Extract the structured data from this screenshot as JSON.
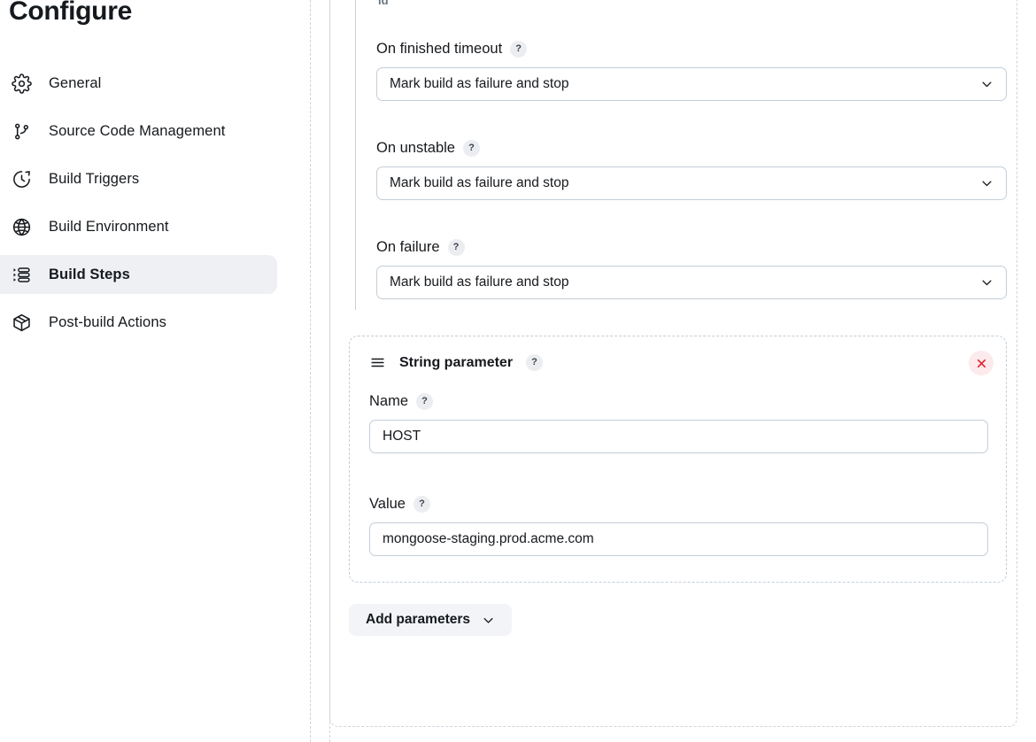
{
  "sidebar": {
    "title": "Configure",
    "items": [
      {
        "label": "General",
        "icon": "gear-icon",
        "active": false
      },
      {
        "label": "Source Code Management",
        "icon": "git-branch-icon",
        "active": false
      },
      {
        "label": "Build Triggers",
        "icon": "clock-icon",
        "active": false
      },
      {
        "label": "Build Environment",
        "icon": "globe-icon",
        "active": false
      },
      {
        "label": "Build Steps",
        "icon": "list-steps-icon",
        "active": true
      },
      {
        "label": "Post-build Actions",
        "icon": "package-icon",
        "active": false
      }
    ]
  },
  "main": {
    "clipped_top_text": "id",
    "help_badge": "?",
    "fields": [
      {
        "label": "On finished timeout",
        "value": "Mark build as failure and stop"
      },
      {
        "label": "On unstable",
        "value": "Mark build as failure and stop"
      },
      {
        "label": "On failure",
        "value": "Mark build as failure and stop"
      }
    ],
    "parameter_card": {
      "title": "String parameter",
      "name_label": "Name",
      "name_value": "HOST",
      "name_placeholder": "",
      "value_label": "Value",
      "value_value": "mongoose-staging.prod.acme.com",
      "value_placeholder": ""
    },
    "add_parameters_label": "Add parameters"
  },
  "colors": {
    "active_nav_bg": "#eef0f4",
    "border": "#c3ced8",
    "delete_bg": "#fdeaec",
    "delete_fg": "#e02434",
    "button_bg": "#f2f4f7",
    "text": "#16191d"
  }
}
